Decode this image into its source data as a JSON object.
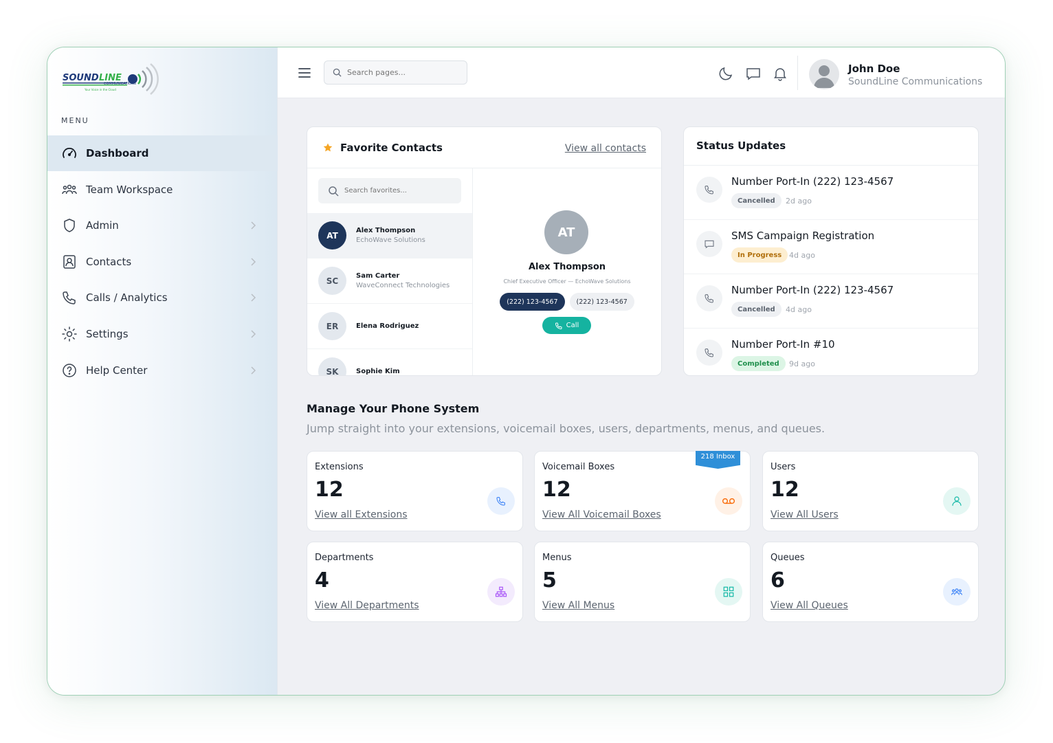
{
  "brand": {
    "logo_main": "SOUNDLINE",
    "logo_sub": "COMMUNICATIONS",
    "logo_tagline": "Your Voice in the Cloud",
    "logo_colors": {
      "navy": "#1e3a7a",
      "green": "#36b14b",
      "grey": "#8f969e"
    }
  },
  "sidebar": {
    "menu_heading": "MENU",
    "items": [
      {
        "label": "Dashboard",
        "icon": "gauge-icon",
        "active": true
      },
      {
        "label": "Team Workspace",
        "icon": "team-icon"
      },
      {
        "label": "Admin",
        "icon": "shield-icon"
      },
      {
        "label": "Contacts",
        "icon": "contact-card-icon"
      },
      {
        "label": "Calls / Analytics",
        "icon": "phone-icon"
      },
      {
        "label": "Settings",
        "icon": "sun-gear-icon"
      },
      {
        "label": "Help Center",
        "icon": "help-icon"
      }
    ]
  },
  "topbar": {
    "search_placeholder": "Search pages...",
    "user_name": "John Doe",
    "user_company": "SoundLine Communications"
  },
  "favorites": {
    "title": "Favorite Contacts",
    "view_all": "View all contacts",
    "search_placeholder": "Search favorites...",
    "contacts": [
      {
        "initials": "AT",
        "name": "Alex Thompson",
        "company": "EchoWave Solutions",
        "selected": true
      },
      {
        "initials": "SC",
        "name": "Sam Carter",
        "company": "WaveConnect Technologies"
      },
      {
        "initials": "ER",
        "name": "Elena Rodriguez",
        "company": ""
      },
      {
        "initials": "SK",
        "name": "Sophie Kim",
        "company": ""
      }
    ],
    "detail": {
      "initials": "AT",
      "name": "Alex Thompson",
      "title": "Chief Executive Officer — EchoWave Solutions",
      "phone_primary": "(222) 123-4567",
      "phone_secondary": "(222) 123-4567",
      "call_label": "Call"
    }
  },
  "status_updates": {
    "title": "Status Updates",
    "items": [
      {
        "title": "Number Port-In (222) 123-4567",
        "status": "Cancelled",
        "time": "2d ago",
        "icon": "phone-icon"
      },
      {
        "title": "SMS Campaign Registration",
        "status": "In Progress",
        "time": "4d ago",
        "icon": "message-icon"
      },
      {
        "title": "Number Port-In (222) 123-4567",
        "status": "Cancelled",
        "time": "4d ago",
        "icon": "phone-icon"
      },
      {
        "title": "Number Port-In #10",
        "status": "Completed",
        "time": "9d ago",
        "icon": "phone-icon"
      }
    ]
  },
  "manage": {
    "title": "Manage Your Phone System",
    "subtitle": "Jump straight into your extensions, voicemail boxes, users, departments, menus, and queues.",
    "cards": [
      {
        "label": "Extensions",
        "value": "12",
        "link": "View all Extensions",
        "icon": "phone-icon",
        "color": "#3b82f6"
      },
      {
        "label": "Voicemail Boxes",
        "value": "12",
        "link": "View All Voicemail Boxes",
        "icon": "voicemail-icon",
        "color": "#f97316",
        "ribbon": "218 Inbox"
      },
      {
        "label": "Users",
        "value": "12",
        "link": "View All Users",
        "icon": "user-icon",
        "color": "#14b8a6"
      },
      {
        "label": "Departments",
        "value": "4",
        "link": "View All Departments",
        "icon": "org-chart-icon",
        "color": "#a855f7"
      },
      {
        "label": "Menus",
        "value": "5",
        "link": "View All Menus",
        "icon": "grid-icon",
        "color": "#14b8a6"
      },
      {
        "label": "Queues",
        "value": "6",
        "link": "View All Queues",
        "icon": "users-group-icon",
        "color": "#3b82f6"
      }
    ]
  }
}
